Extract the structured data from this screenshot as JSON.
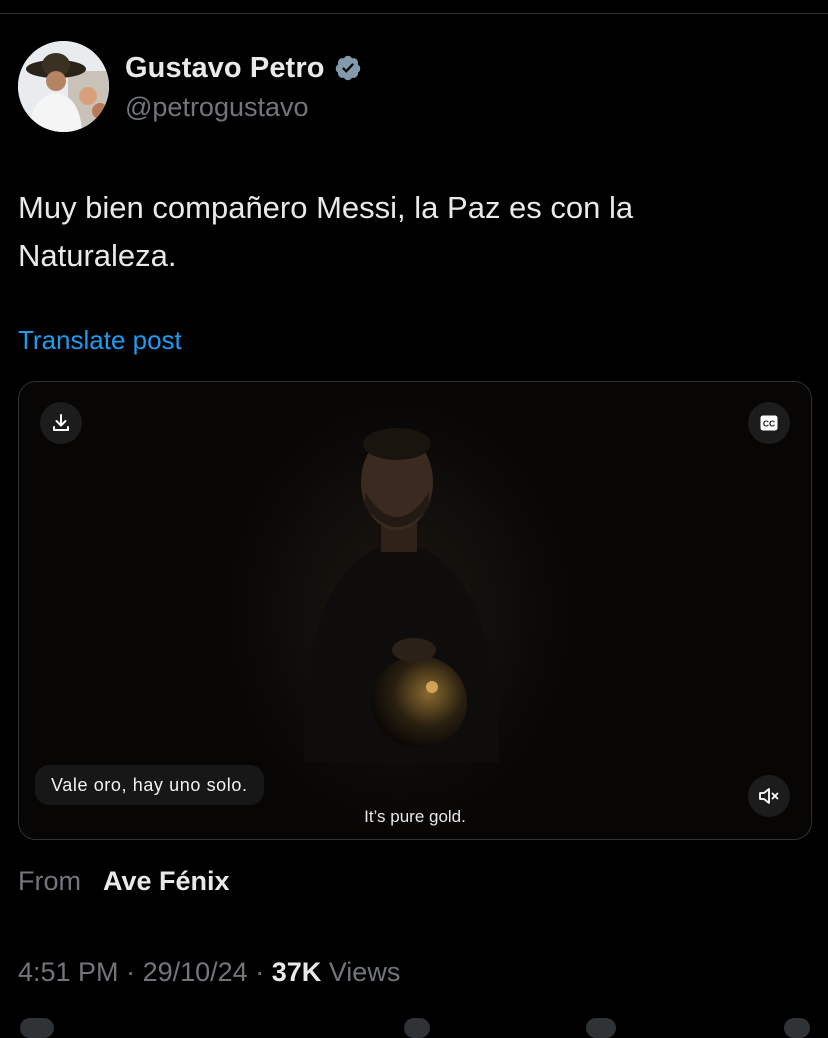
{
  "author": {
    "name": "Gustavo Petro",
    "handle": "@petrogustavo"
  },
  "post": {
    "text": "Muy bien compañero Messi, la Paz es con la Naturaleza.",
    "translate_label": "Translate post"
  },
  "media": {
    "download_icon": "download-icon",
    "cc_icon": "closed-captions-icon",
    "cc_label": "CC",
    "mute_icon": "muted-speaker-icon",
    "caption_text": "Vale oro, hay uno solo.",
    "subtitle_text": "It’s pure gold."
  },
  "source": {
    "from_label": "From",
    "from_name": "Ave Fénix"
  },
  "meta": {
    "time": "4:51 PM",
    "separator": "·",
    "date": "29/10/24",
    "views_count": "37K",
    "views_label": "Views"
  },
  "colors": {
    "background": "#000000",
    "text": "#e7e9ea",
    "secondary": "#71767b",
    "link": "#1d9bf0",
    "border": "#2f3336"
  }
}
